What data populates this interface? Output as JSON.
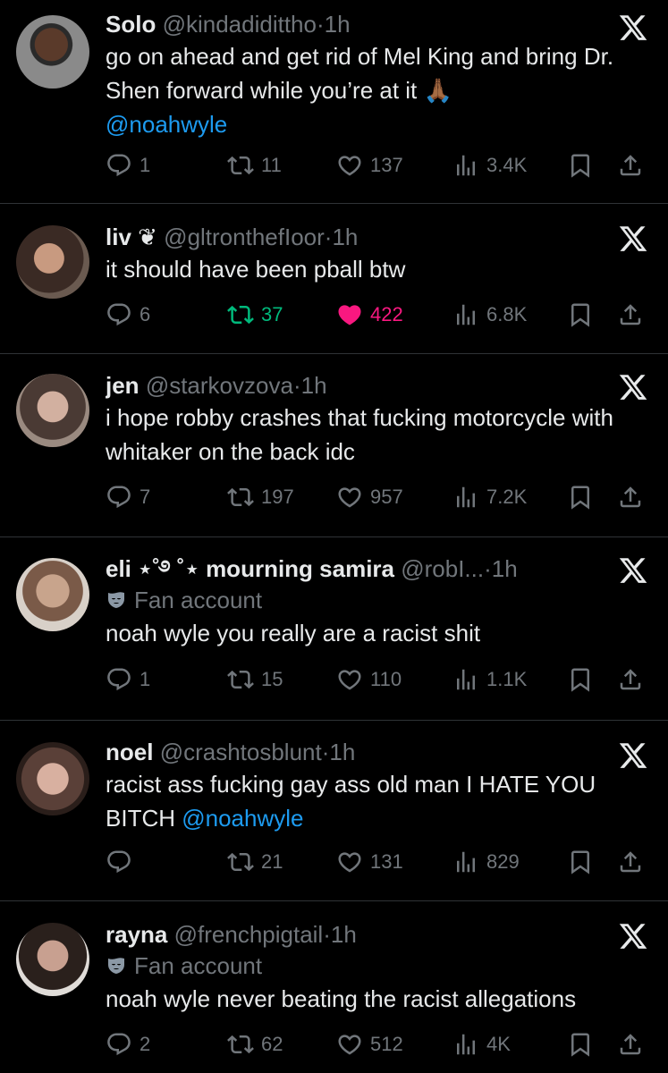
{
  "tweets": [
    {
      "name": "Solo",
      "name_suffix": "",
      "handle": "@kindadidittho",
      "time": "1h",
      "badge": "",
      "text": "go on ahead and get rid of Mel King and bring Dr. Shen forward while you’re at it 🙏🏾",
      "mention": "@noahwyle",
      "replies": "1",
      "reposts": "11",
      "likes": "137",
      "views": "3.4K",
      "liked": false,
      "reposted": false
    },
    {
      "name": "liv",
      "name_suffix": " ❦",
      "handle": "@gltronthefIoor",
      "time": "1h",
      "badge": "",
      "text": "it should have been pball btw",
      "mention": "",
      "replies": "6",
      "reposts": "37",
      "likes": "422",
      "views": "6.8K",
      "liked": true,
      "reposted": true
    },
    {
      "name": "jen",
      "name_suffix": "",
      "handle": "@starkovzova",
      "time": "1h",
      "badge": "",
      "text": "i hope robby crashes that fucking motorcycle with whitaker on the back idc",
      "mention": "",
      "replies": "7",
      "reposts": "197",
      "likes": "957",
      "views": "7.2K",
      "liked": false,
      "reposted": false
    },
    {
      "name": "eli ⋆˚࿔ ˚⋆ mourning samira",
      "name_suffix": "",
      "handle": "@robI...",
      "time": "1h",
      "badge": "Fan account",
      "text": "noah wyle you really are a racist shit",
      "mention": "",
      "replies": "1",
      "reposts": "15",
      "likes": "110",
      "views": "1.1K",
      "liked": false,
      "reposted": false
    },
    {
      "name": "noel",
      "name_suffix": "",
      "handle": "@crashtosblunt",
      "time": "1h",
      "badge": "",
      "text": "racist ass fucking gay ass old man I HATE YOU BITCH",
      "mention": "@noahwyle",
      "replies": "",
      "reposts": "21",
      "likes": "131",
      "views": "829",
      "liked": false,
      "reposted": false
    },
    {
      "name": "rayna",
      "name_suffix": "",
      "handle": "@frenchpigtail",
      "time": "1h",
      "badge": "Fan account",
      "text": "noah wyle never beating the racist allegations",
      "mention": "",
      "replies": "2",
      "reposts": "62",
      "likes": "512",
      "views": "4K",
      "liked": false,
      "reposted": false
    }
  ],
  "separator": "·",
  "colors": {
    "background": "#000000",
    "text": "#e7e9ea",
    "muted": "#71767b",
    "link": "#1d9bf0",
    "repost_active": "#00ba7c",
    "like_active": "#f91880",
    "divider": "#2f3336"
  },
  "icons": [
    "reply-icon",
    "repost-icon",
    "like-icon",
    "views-icon",
    "bookmark-icon",
    "share-icon",
    "x-logo-icon",
    "fan-account-mask-icon"
  ]
}
